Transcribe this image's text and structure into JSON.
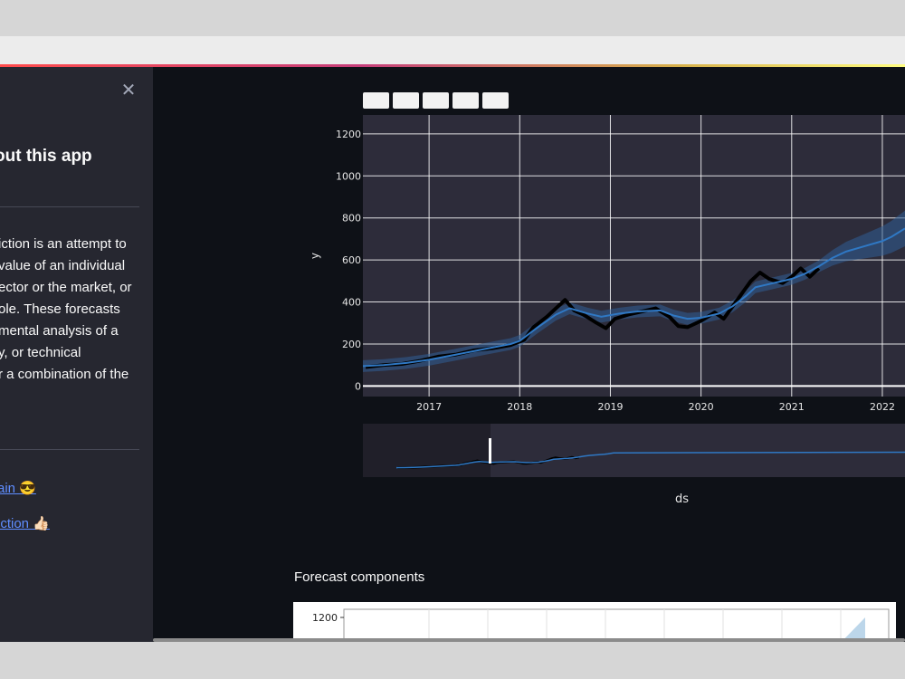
{
  "sidebar": {
    "close_icon": "close-icon",
    "title": "out this app",
    "description_lines": [
      "iction is an attempt to",
      "value of an individual",
      "ector or the market, or",
      "ole. These forecasts",
      "mental analysis of a",
      "y, or technical",
      "r a combination of the"
    ],
    "links": [
      {
        "label": "ain 😎"
      },
      {
        "label": "iction 👍🏻"
      }
    ]
  },
  "colors": {
    "app_bg": "#0e1117",
    "sidebar_bg": "#262730",
    "plot_bg": "#2d2c3a",
    "forecast_line": "#2f78c4",
    "band": "#2f5f95",
    "actual_points": "#000000",
    "link": "#5f8dff"
  },
  "chart_data": {
    "type": "line",
    "xlabel": "ds",
    "ylabel": "y",
    "x_ticks": [
      "2017",
      "2018",
      "2019",
      "2020",
      "2021",
      "2022"
    ],
    "y_ticks": [
      "0",
      "200",
      "400",
      "600",
      "800",
      "1000",
      "1200"
    ],
    "ylim": [
      -50,
      1290
    ],
    "xlim": [
      2016.27,
      2022.25
    ],
    "grid": true,
    "rangeslider": true,
    "series": [
      {
        "kind": "forecast",
        "points": [
          [
            2016.27,
            95
          ],
          [
            2016.5,
            100
          ],
          [
            2016.75,
            110
          ],
          [
            2017.0,
            125
          ],
          [
            2017.3,
            150
          ],
          [
            2017.6,
            175
          ],
          [
            2017.9,
            200
          ],
          [
            2018.0,
            215
          ],
          [
            2018.2,
            280
          ],
          [
            2018.4,
            340
          ],
          [
            2018.55,
            370
          ],
          [
            2018.75,
            345
          ],
          [
            2018.9,
            330
          ],
          [
            2019.1,
            345
          ],
          [
            2019.3,
            355
          ],
          [
            2019.55,
            360
          ],
          [
            2019.7,
            335
          ],
          [
            2019.85,
            320
          ],
          [
            2020.0,
            325
          ],
          [
            2020.2,
            345
          ],
          [
            2020.35,
            380
          ],
          [
            2020.5,
            430
          ],
          [
            2020.6,
            470
          ],
          [
            2020.75,
            485
          ],
          [
            2020.9,
            500
          ],
          [
            2021.0,
            510
          ],
          [
            2021.15,
            535
          ],
          [
            2021.3,
            570
          ],
          [
            2021.45,
            610
          ],
          [
            2021.6,
            640
          ],
          [
            2021.8,
            665
          ],
          [
            2022.0,
            690
          ],
          [
            2022.1,
            710
          ],
          [
            2022.25,
            750
          ]
        ]
      },
      {
        "kind": "actual",
        "points": [
          [
            2016.3,
            90
          ],
          [
            2016.5,
            100
          ],
          [
            2016.7,
            105
          ],
          [
            2016.9,
            120
          ],
          [
            2017.1,
            140
          ],
          [
            2017.3,
            150
          ],
          [
            2017.5,
            170
          ],
          [
            2017.7,
            180
          ],
          [
            2017.9,
            195
          ],
          [
            2018.05,
            220
          ],
          [
            2018.15,
            280
          ],
          [
            2018.3,
            330
          ],
          [
            2018.4,
            370
          ],
          [
            2018.5,
            410
          ],
          [
            2018.6,
            360
          ],
          [
            2018.7,
            340
          ],
          [
            2018.85,
            300
          ],
          [
            2018.95,
            275
          ],
          [
            2019.05,
            320
          ],
          [
            2019.2,
            340
          ],
          [
            2019.35,
            355
          ],
          [
            2019.5,
            370
          ],
          [
            2019.65,
            330
          ],
          [
            2019.75,
            285
          ],
          [
            2019.85,
            280
          ],
          [
            2020.0,
            310
          ],
          [
            2020.15,
            350
          ],
          [
            2020.25,
            320
          ],
          [
            2020.35,
            380
          ],
          [
            2020.45,
            440
          ],
          [
            2020.55,
            500
          ],
          [
            2020.65,
            540
          ],
          [
            2020.75,
            510
          ],
          [
            2020.9,
            490
          ],
          [
            2021.0,
            520
          ],
          [
            2021.1,
            560
          ],
          [
            2021.2,
            520
          ],
          [
            2021.3,
            560
          ]
        ]
      }
    ]
  },
  "modebar_buttons": 5,
  "forecast_components": {
    "title": "Forecast components",
    "y_tick": "1200"
  }
}
